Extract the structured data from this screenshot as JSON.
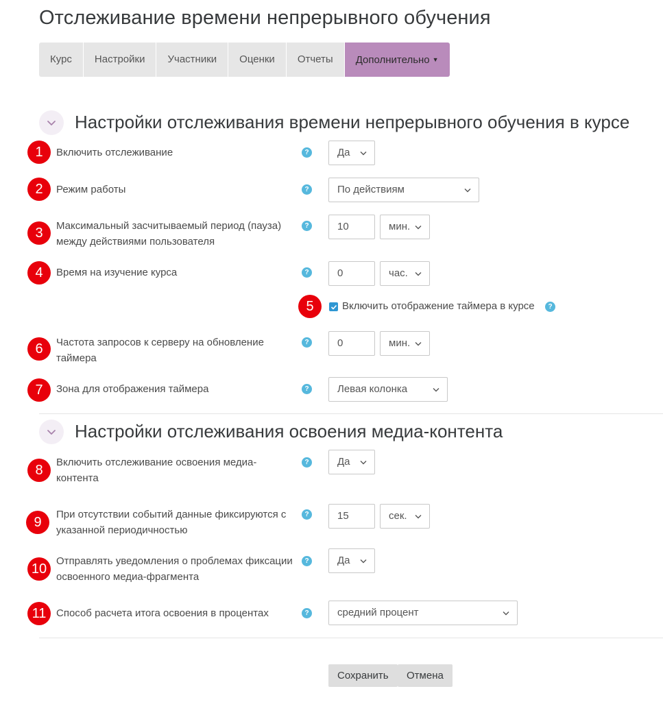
{
  "page_title": "Отслеживание времени непрерывного обучения",
  "tabs": [
    "Курс",
    "Настройки",
    "Участники",
    "Оценки",
    "Отчеты",
    "Дополнительно"
  ],
  "section1": {
    "title": "Настройки отслеживания времени непрерывного обучения в курсе",
    "fields": {
      "enable_tracking": {
        "num": "1",
        "label": "Включить отслеживание",
        "value": "Да"
      },
      "mode": {
        "num": "2",
        "label": "Режим работы",
        "value": "По действиям"
      },
      "max_pause": {
        "num": "3",
        "label": "Максимальный засчитываемый период (пауза) между действиями пользователя",
        "value": "10",
        "unit": "мин."
      },
      "study_time": {
        "num": "4",
        "label": "Время на изучение курса",
        "value": "0",
        "unit": "час."
      },
      "show_timer": {
        "num": "5",
        "label": "Включить отображение таймера в курсе",
        "checked": true
      },
      "request_freq": {
        "num": "6",
        "label": "Частота запросов к серверу на обновление таймера",
        "value": "0",
        "unit": "мин."
      },
      "timer_zone": {
        "num": "7",
        "label": "Зона для отображения таймера",
        "value": "Левая колонка"
      }
    }
  },
  "section2": {
    "title": "Настройки отслеживания освоения медиа-контента",
    "fields": {
      "enable_media": {
        "num": "8",
        "label": "Включить отслеживание освоения медиа-контента",
        "value": "Да"
      },
      "no_events": {
        "num": "9",
        "label": "При отсутствии событий данные фиксируются с указанной периодичностью",
        "value": "15",
        "unit": "сек."
      },
      "notify": {
        "num": "10",
        "label": "Отправлять уведомления о проблемах фиксации освоенного медиа-фрагмента",
        "value": "Да"
      },
      "calc_method": {
        "num": "11",
        "label": "Способ расчета итога освоения в процентах",
        "value": "средний процент"
      }
    }
  },
  "help_symbol": "?",
  "buttons": {
    "save": "Сохранить",
    "cancel": "Отмена"
  },
  "colors": {
    "accent": "#b98bbb",
    "badge": "#e8000b",
    "help": "#56b8dd",
    "checkbox": "#2f97d3"
  },
  "icons": {
    "section_toggle": "chevron-down-icon",
    "help": "question-circle-icon",
    "select": "chevron-down-icon",
    "checkbox": "checkmark-icon"
  }
}
